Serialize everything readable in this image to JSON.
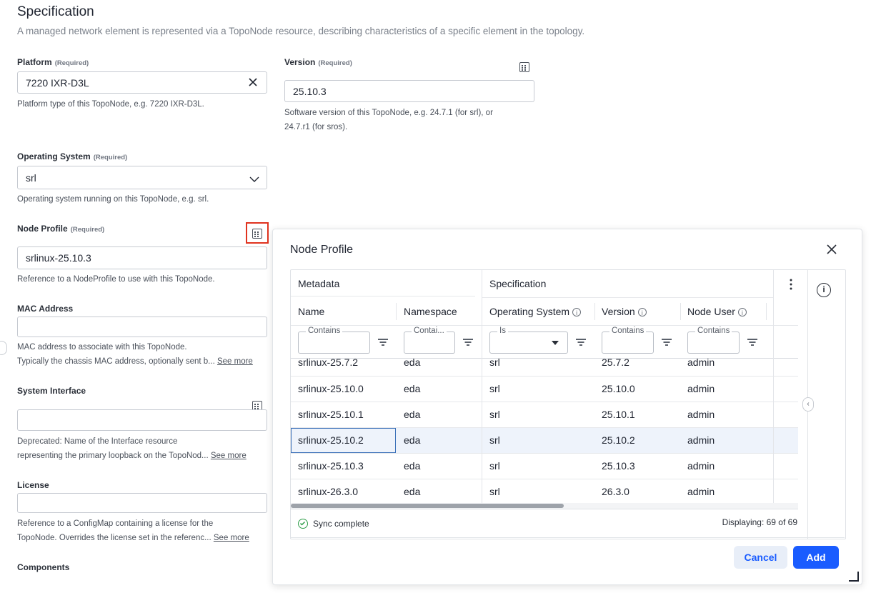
{
  "spec": {
    "title": "Specification",
    "description": "A managed network element is represented via a TopoNode resource, describing characteristics of a specific element in the topology."
  },
  "form": {
    "required_tag": "(Required)",
    "platform": {
      "label": "Platform",
      "value": "7220 IXR-D3L",
      "help": "Platform type of this TopoNode, e.g. 7220 IXR-D3L."
    },
    "version": {
      "label": "Version",
      "value": "25.10.3",
      "help_line1": "Software version of this TopoNode, e.g. 24.7.1 (for srl), or",
      "help_line2": "24.7.r1 (for sros)."
    },
    "os": {
      "label": "Operating System",
      "value": "srl",
      "help": "Operating system running on this TopoNode, e.g. srl."
    },
    "node_profile": {
      "label": "Node Profile",
      "value": "srlinux-25.10.3",
      "help": "Reference to a NodeProfile to use with this TopoNode."
    },
    "mac": {
      "label": "MAC Address",
      "value": "",
      "help_line1": "MAC address to associate with this TopoNode.",
      "help_line2": "Typically the chassis MAC address, optionally sent b..."
    },
    "system_interface": {
      "label": "System Interface",
      "value": "",
      "help_line1": "Deprecated: Name of the Interface resource",
      "help_line2": "representing the primary loopback on the TopoNod..."
    },
    "license": {
      "label": "License",
      "value": "",
      "help_line1": "Reference to a ConfigMap containing a license for the",
      "help_line2": "TopoNode. Overrides the license set in the referenc..."
    },
    "components": {
      "label": "Components"
    },
    "see_more": "See more"
  },
  "dialog": {
    "title": "Node Profile",
    "groups": {
      "metadata": "Metadata",
      "specification": "Specification"
    },
    "columns": {
      "name": "Name",
      "namespace": "Namespace",
      "os": "Operating System",
      "version": "Version",
      "node_user": "Node User"
    },
    "filters": {
      "name": "Contains",
      "namespace": "Contai...",
      "os": "Is",
      "version": "Contains",
      "node_user": "Contains"
    },
    "partial_row": {
      "name": "srlinux-25.7.2",
      "namespace": "eda",
      "os": "srl",
      "version": "25.7.2",
      "node_user": "admin"
    },
    "rows": [
      {
        "name": "srlinux-25.10.0",
        "namespace": "eda",
        "os": "srl",
        "version": "25.10.0",
        "node_user": "admin"
      },
      {
        "name": "srlinux-25.10.1",
        "namespace": "eda",
        "os": "srl",
        "version": "25.10.1",
        "node_user": "admin"
      },
      {
        "name": "srlinux-25.10.2",
        "namespace": "eda",
        "os": "srl",
        "version": "25.10.2",
        "node_user": "admin"
      },
      {
        "name": "srlinux-25.10.3",
        "namespace": "eda",
        "os": "srl",
        "version": "25.10.3",
        "node_user": "admin"
      },
      {
        "name": "srlinux-26.3.0",
        "namespace": "eda",
        "os": "srl",
        "version": "26.3.0",
        "node_user": "admin"
      }
    ],
    "sync_status": "Sync complete",
    "displaying": "Displaying: 69 of 69",
    "cancel": "Cancel",
    "add": "Add"
  },
  "colors": {
    "accent": "#1a5cff",
    "selected_row": "#eef3fb",
    "sync_green": "#2e9e49",
    "highlight_box": "#e0331f"
  }
}
